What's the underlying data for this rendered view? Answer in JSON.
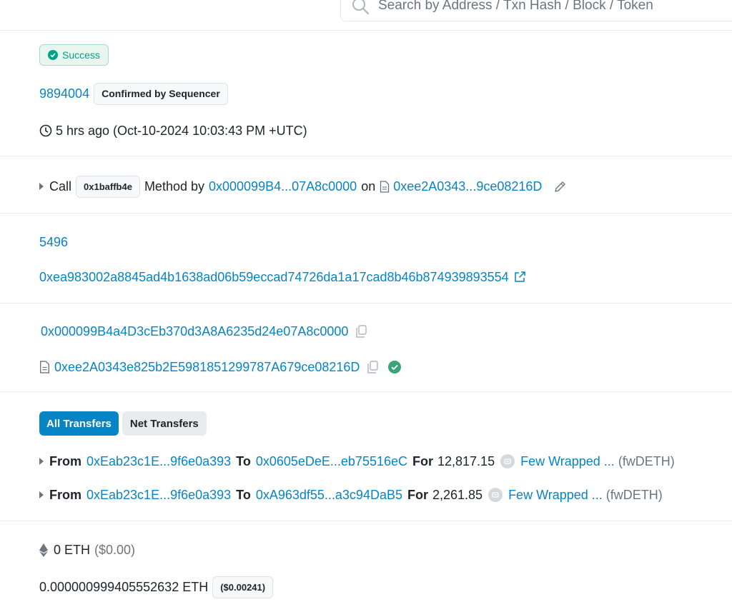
{
  "search": {
    "placeholder": "Search by Address / Txn Hash / Block / Token"
  },
  "status": {
    "label": "Success"
  },
  "block": {
    "number": "9894004",
    "confirmation": "Confirmed by Sequencer"
  },
  "timestamp": {
    "text": "5 hrs ago (Oct-10-2024 10:03:43 PM +UTC)"
  },
  "action": {
    "call_label": "Call",
    "method_id": "0x1baffb4e",
    "method_by_label": "Method by",
    "from_address": "0x000099B4...07A8c0000",
    "on_label": "on",
    "to_contract": "0xee2A0343...9ce08216D"
  },
  "batch": {
    "index": "5496",
    "l1_hash": "0xea983002a8845ad4b1638ad06b59eccad74726da1a17cad8b46b874939893554"
  },
  "from": {
    "address": "0x000099B4a4D3cEb370d3A8A6235d24e07A8c0000"
  },
  "to": {
    "contract": "0xee2A0343e825b2E5981851299787A679ce08216D"
  },
  "transfers_tabs": {
    "all": "All Transfers",
    "net": "Net Transfers"
  },
  "transfers": [
    {
      "from_label": "From",
      "from": "0xEab23c1E...9f6e0a393",
      "to_label": "To",
      "to": "0x0605eDeE...eb75516eC",
      "for_label": "For",
      "amount": "12,817.15",
      "token_name": "Few Wrapped ...",
      "token_symbol": "(fwDETH)"
    },
    {
      "from_label": "From",
      "from": "0xEab23c1E...9f6e0a393",
      "to_label": "To",
      "to": "0xA963df55...a3c94DaB5",
      "for_label": "For",
      "amount": "2,261.85",
      "token_name": "Few Wrapped ...",
      "token_symbol": "(fwDETH)"
    }
  ],
  "value": {
    "eth": "0 ETH",
    "usd": "($0.00)"
  },
  "fee": {
    "eth": "0.000000999405552632 ETH",
    "usd": "($0.00241)"
  },
  "colors": {
    "link": "#0784c3",
    "success": "#00a186",
    "muted": "#6c757d"
  },
  "icons": [
    "search-icon",
    "check-icon",
    "clock-icon",
    "caret-right-icon",
    "document-icon",
    "pencil-icon",
    "external-link-icon",
    "copy-icon",
    "verified-check-icon",
    "token-icon",
    "ethereum-icon"
  ]
}
